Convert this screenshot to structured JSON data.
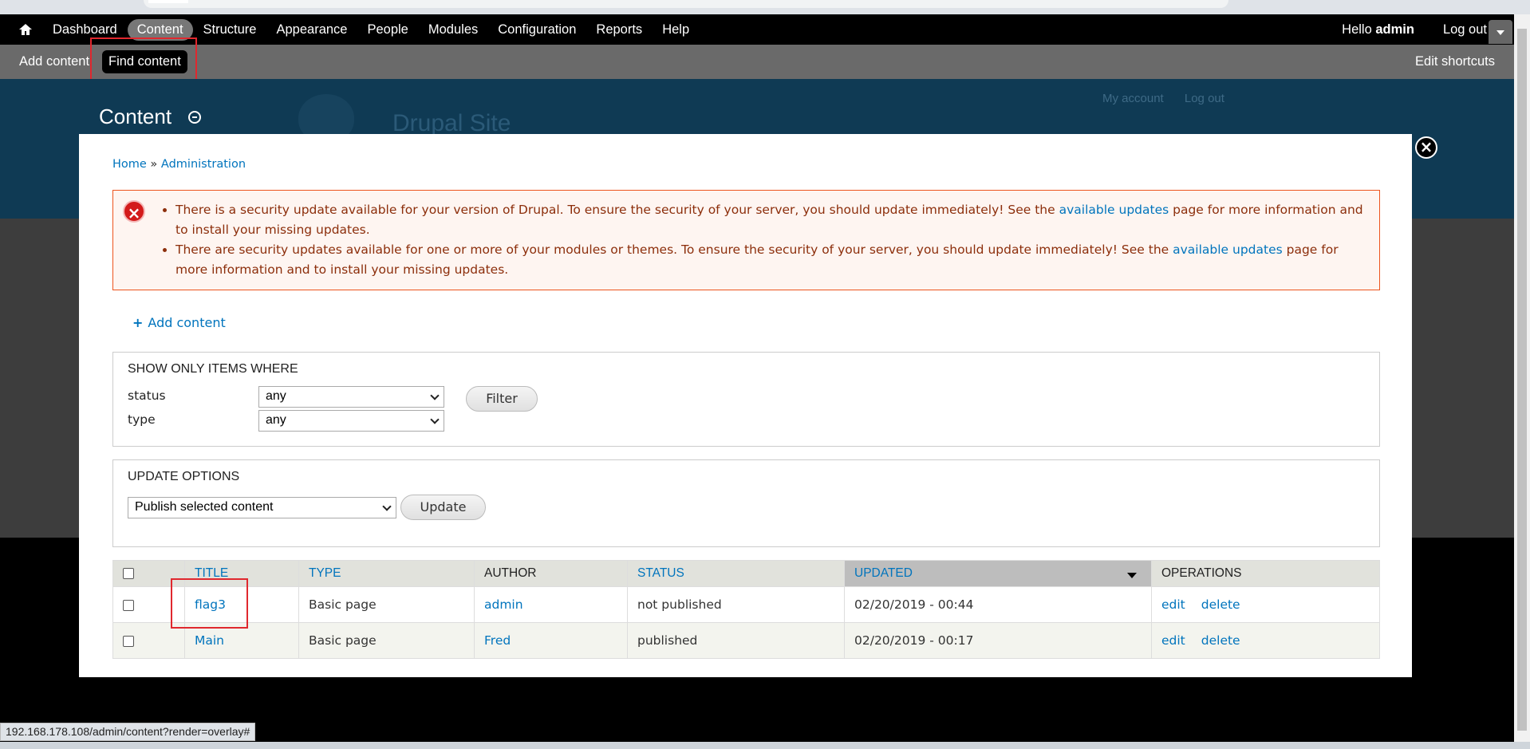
{
  "toolbar": {
    "menu": [
      "Dashboard",
      "Content",
      "Structure",
      "Appearance",
      "People",
      "Modules",
      "Configuration",
      "Reports",
      "Help"
    ],
    "hello_prefix": "Hello ",
    "username": "admin",
    "logout": "Log out"
  },
  "shortcuts": {
    "add_content": "Add content",
    "find_content": "Find content",
    "edit_shortcuts": "Edit shortcuts"
  },
  "site": {
    "page_title": "Content",
    "site_name": "Drupal Site",
    "my_account": "My account",
    "log_out": "Log out"
  },
  "breadcrumb": {
    "home": "Home",
    "separator": " » ",
    "administration": "Administration"
  },
  "messages": {
    "error_icon": "error-x-icon",
    "msg1_before": "There is a security update available for your version of Drupal. To ensure the security of your server, you should update immediately! See the ",
    "msg1_link": "available updates",
    "msg1_after": " page for more information and to install your missing updates.",
    "msg2_before": "There are security updates available for one or more of your modules or themes. To ensure the security of your server, you should update immediately! See the ",
    "msg2_link": "available updates",
    "msg2_after": " page for more information and to install your missing updates."
  },
  "add_content_link": "Add content",
  "filter": {
    "legend": "Show only items where",
    "status_label": "status",
    "status_value": "any",
    "type_label": "type",
    "type_value": "any",
    "button": "Filter"
  },
  "update_options": {
    "legend": "Update options",
    "selected": "Publish selected content",
    "button": "Update"
  },
  "table": {
    "headers": {
      "title": "Title",
      "type": "Type",
      "author": "Author",
      "status": "Status",
      "updated": "Updated",
      "operations": "Operations"
    },
    "rows": [
      {
        "title": "flag3",
        "type": "Basic page",
        "author": "admin",
        "status": "not published",
        "updated": "02/20/2019 - 00:44",
        "edit": "edit",
        "delete": "delete"
      },
      {
        "title": "Main",
        "type": "Basic page",
        "author": "Fred",
        "status": "published",
        "updated": "02/20/2019 - 00:17",
        "edit": "edit",
        "delete": "delete"
      }
    ]
  },
  "statusbar": {
    "url": "192.168.178.108/admin/content?render=overlay#"
  },
  "colors": {
    "toolbar_bg": "#000000",
    "shortcut_bg": "#6a6a6a",
    "link": "#0074bd",
    "error_border": "#ed541d",
    "error_bg": "#fef5f1",
    "highlight": "#e0282e"
  }
}
